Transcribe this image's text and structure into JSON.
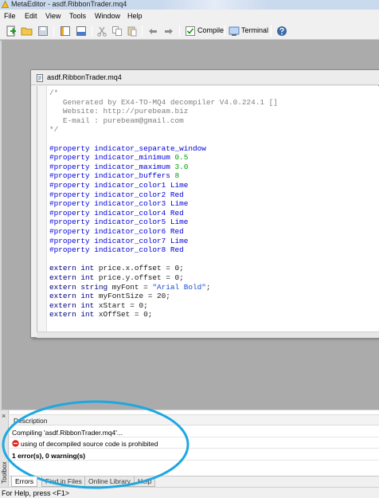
{
  "window": {
    "title": "MetaEditor - asdf.RibbonTrader.mq4"
  },
  "menu": [
    {
      "id": "file",
      "label": "File"
    },
    {
      "id": "edit",
      "label": "Edit"
    },
    {
      "id": "view",
      "label": "View"
    },
    {
      "id": "tools",
      "label": "Tools"
    },
    {
      "id": "window",
      "label": "Window"
    },
    {
      "id": "help",
      "label": "Help"
    }
  ],
  "toolbar": {
    "compile_label": "Compile",
    "terminal_label": "Terminal"
  },
  "editor": {
    "filename": "asdf.RibbonTrader.mq4",
    "code": [
      {
        "cls": "cm",
        "text": "/*"
      },
      {
        "cls": "cm",
        "text": "   Generated by EX4-TO-MQ4 decompiler V4.0.224.1 []"
      },
      {
        "cls": "cm",
        "text": "   Website: http://purebeam.biz"
      },
      {
        "cls": "cm",
        "text": "   E-mail : purebeam@gmail.com"
      },
      {
        "cls": "cm",
        "text": "*/"
      },
      {
        "cls": "plain",
        "text": ""
      },
      {
        "cls": "pp",
        "text": "#property indicator_separate_window"
      },
      {
        "cls": "pp",
        "text": "#property indicator_minimum ",
        "num": "0.5"
      },
      {
        "cls": "pp",
        "text": "#property indicator_maximum ",
        "num": "3.0"
      },
      {
        "cls": "pp",
        "text": "#property indicator_buffers ",
        "num": "8"
      },
      {
        "cls": "pp",
        "text": "#property indicator_color1 Lime"
      },
      {
        "cls": "pp",
        "text": "#property indicator_color2 Red"
      },
      {
        "cls": "pp",
        "text": "#property indicator_color3 Lime"
      },
      {
        "cls": "pp",
        "text": "#property indicator_color4 Red"
      },
      {
        "cls": "pp",
        "text": "#property indicator_color5 Lime"
      },
      {
        "cls": "pp",
        "text": "#property indicator_color6 Red"
      },
      {
        "cls": "pp",
        "text": "#property indicator_color7 Lime"
      },
      {
        "cls": "pp",
        "text": "#property indicator_color8 Red"
      },
      {
        "cls": "plain",
        "text": ""
      },
      {
        "cls": "kw",
        "text": "extern int ",
        "rest": "price.x.offset = 0;"
      },
      {
        "cls": "kw",
        "text": "extern int ",
        "rest": "price.y.offset = 0;"
      },
      {
        "cls": "kw",
        "text": "extern string ",
        "rest": "myFont = ",
        "str": "\"Arial Bold\"",
        "tail": ";"
      },
      {
        "cls": "kw",
        "text": "extern int ",
        "rest": "myFontSize = 20;"
      },
      {
        "cls": "kw",
        "text": "extern int ",
        "rest": "xStart = 0;"
      },
      {
        "cls": "kw",
        "text": "extern int ",
        "rest": "xOffSet = 0;"
      }
    ]
  },
  "toolbox": {
    "side_label": "Toolbox",
    "column_header": "Description",
    "rows": [
      {
        "type": "info",
        "text": "Compiling 'asdf.RibbonTrader.mq4'..."
      },
      {
        "type": "error",
        "text": "using of decompiled source code is prohibited"
      },
      {
        "type": "summary",
        "text": "1 error(s), 0 warning(s)"
      }
    ],
    "tabs": [
      {
        "id": "errors",
        "label": "Errors",
        "active": true
      },
      {
        "id": "find-in-files",
        "label": "Find in Files",
        "active": false
      },
      {
        "id": "online-library",
        "label": "Online Library",
        "active": false
      },
      {
        "id": "help",
        "label": "Help",
        "active": false
      }
    ]
  },
  "status": {
    "text": "For Help, press <F1>"
  },
  "colors": {
    "annotation": "#1ea7e1",
    "error": "#d9261c",
    "preprocessor": "#0000d8",
    "number": "#00a000",
    "comment": "#7f7f7f"
  }
}
